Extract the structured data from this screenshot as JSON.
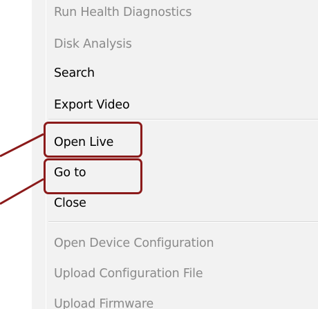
{
  "menu": {
    "items": [
      {
        "label": "Run Health Diagnostics",
        "enabled": false
      },
      {
        "label": "Disk Analysis",
        "enabled": false
      },
      {
        "label": "Search",
        "enabled": true
      },
      {
        "label": "Export Video",
        "enabled": true
      },
      {
        "label": "Open Live",
        "enabled": true,
        "highlighted": true
      },
      {
        "label": "Go to",
        "enabled": true,
        "highlighted": true
      },
      {
        "label": "Close",
        "enabled": true
      },
      {
        "label": "Open Device Configuration",
        "enabled": false
      },
      {
        "label": "Upload Configuration File",
        "enabled": false
      },
      {
        "label": "Upload Firmware",
        "enabled": false
      }
    ]
  },
  "colors": {
    "menu_background": "#f2f2f2",
    "enabled_text": "#000000",
    "disabled_text": "#8a8a8a",
    "callout": "#8b1a1a"
  }
}
